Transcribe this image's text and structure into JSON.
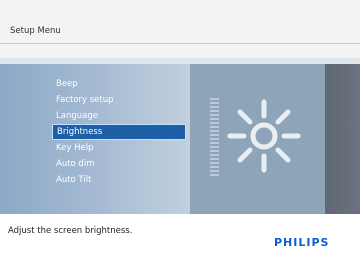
{
  "header": {
    "title": "Setup Menu"
  },
  "menu": {
    "items": [
      {
        "label": "Beep",
        "selected": false
      },
      {
        "label": "Factory setup",
        "selected": false
      },
      {
        "label": "Language",
        "selected": false
      },
      {
        "label": "Brightness",
        "selected": true
      },
      {
        "label": "Key Help",
        "selected": false
      },
      {
        "label": "Auto dim",
        "selected": false
      },
      {
        "label": "Auto Tilt",
        "selected": false
      }
    ]
  },
  "preview": {
    "icon": "sun-brightness-icon"
  },
  "footer": {
    "help_text": "Adjust the screen brightness.",
    "brand": "PHILIPS"
  },
  "colors": {
    "accent": "#1e5fa6",
    "brand": "#0b5ed7",
    "menu_panel": "#a7bcd3",
    "preview_panel": "#8da4b9"
  }
}
